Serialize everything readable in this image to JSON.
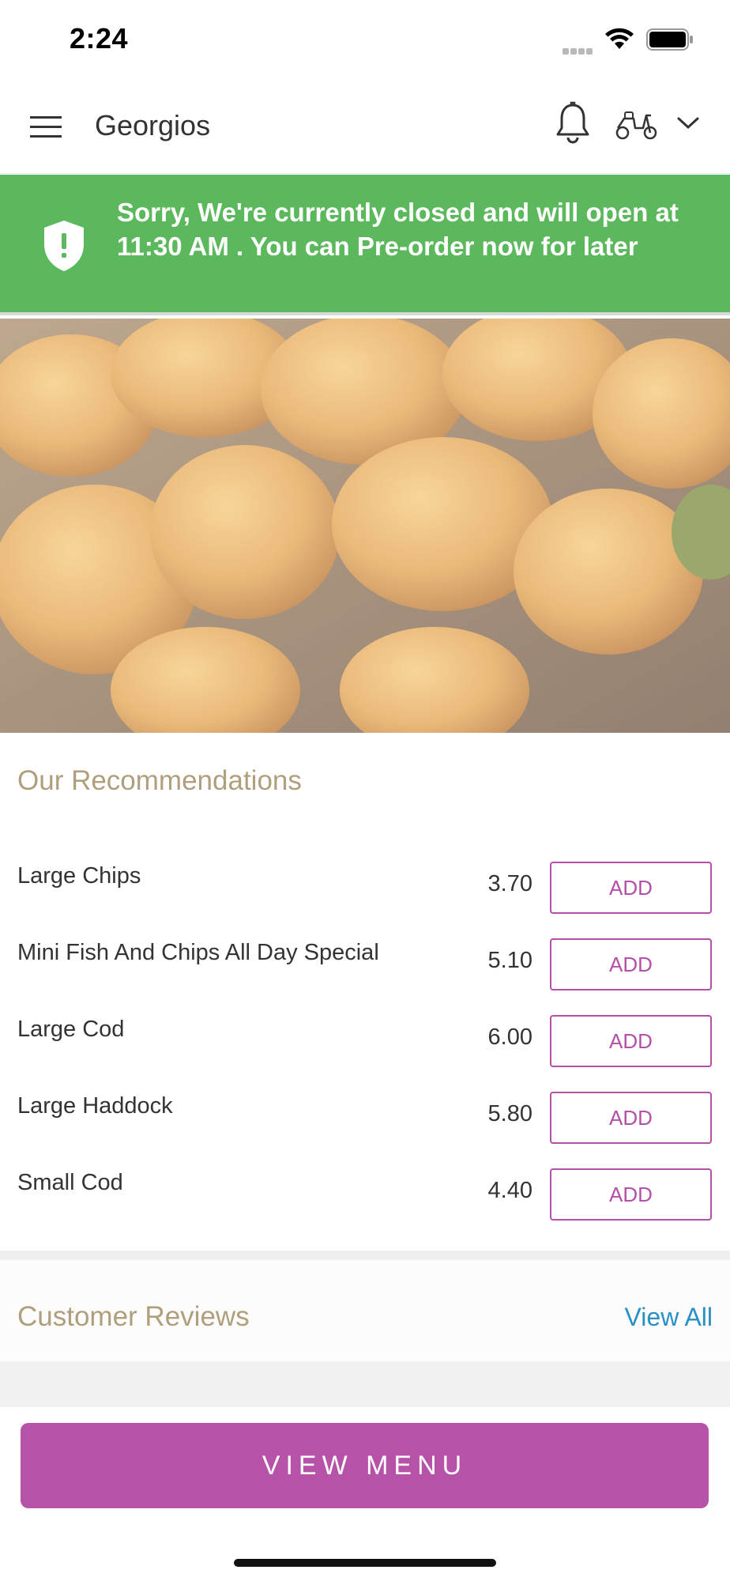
{
  "status_bar": {
    "time": "2:24"
  },
  "header": {
    "title": "Georgios"
  },
  "banner": {
    "text": "Sorry, We're currently closed and will open at 11:30 AM . You can Pre-order now for later"
  },
  "recommendations": {
    "title": "Our Recommendations",
    "items": [
      {
        "name": "Large Chips",
        "price": "3.70",
        "action": "ADD"
      },
      {
        "name": "Mini Fish And Chips All Day Special",
        "price": "5.10",
        "action": "ADD"
      },
      {
        "name": "Large Cod",
        "price": "6.00",
        "action": "ADD"
      },
      {
        "name": "Large Haddock",
        "price": "5.80",
        "action": "ADD"
      },
      {
        "name": "Small Cod",
        "price": "4.40",
        "action": "ADD"
      }
    ]
  },
  "reviews": {
    "title": "Customer Reviews",
    "view_all": "View All"
  },
  "footer": {
    "button_label": "VIEW MENU"
  },
  "colors": {
    "banner": "#5cb85c",
    "accent": "#b653a9",
    "section_title": "#b09f7c",
    "link": "#2a8fc4"
  },
  "icons": [
    "wifi-icon",
    "battery-icon",
    "menu-icon",
    "bell-icon",
    "scooter-icon",
    "chevron-down-icon",
    "shield-icon"
  ]
}
